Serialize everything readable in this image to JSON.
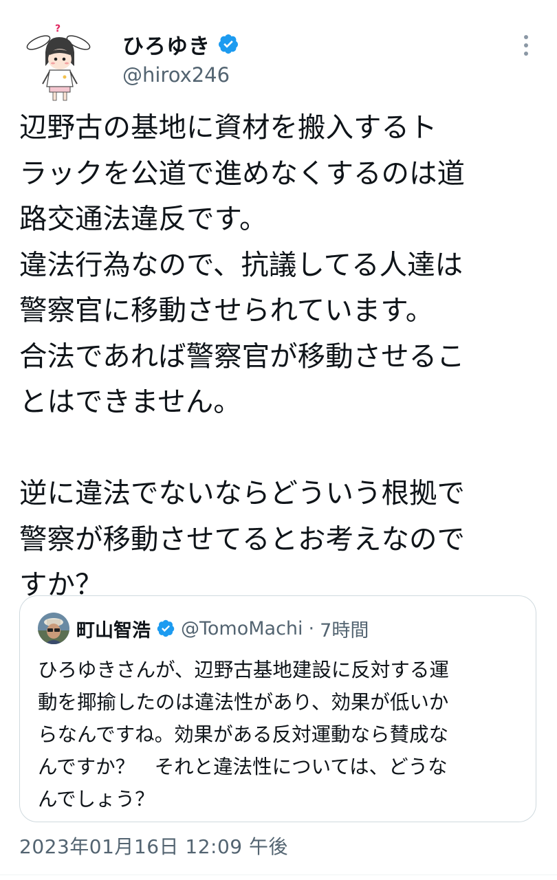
{
  "author": {
    "display_name": "ひろゆき",
    "handle": "@hirox246",
    "verified": true
  },
  "tweet": {
    "text": "辺野古の基地に資材を搬入するト\nラックを公道で進めなくするのは道\n路交通法違反です。\n違法行為なので、抗議してる人達は\n警察官に移動させられています。\n合法であれば警察官が移動させるこ\nとはできません。\n\n逆に違法でないならどういう根拠で\n警察が移動させてるとお考えなので\nすか？",
    "timestamp": "2023年01月16日 12:09 午後"
  },
  "quoted_tweet": {
    "display_name": "町山智浩",
    "handle": "@TomoMachi",
    "separator": "·",
    "time": "7時間",
    "verified": true,
    "text": "ひろゆきさんが、辺野古基地建設に反対する運\n動を揶揄したのは違法性があり、効果が低いか\nらなんですね。効果がある反対運動なら賛成な\nんですか？　それと違法性については、どうな\nんでしょう？"
  },
  "icons": {
    "verified": "verified-badge-icon",
    "more": "more-vertical-icon"
  },
  "colors": {
    "verified_blue": "#1d9bf0",
    "secondary_text": "#536471",
    "border": "#cfd9de",
    "primary_text": "#0f1419"
  }
}
